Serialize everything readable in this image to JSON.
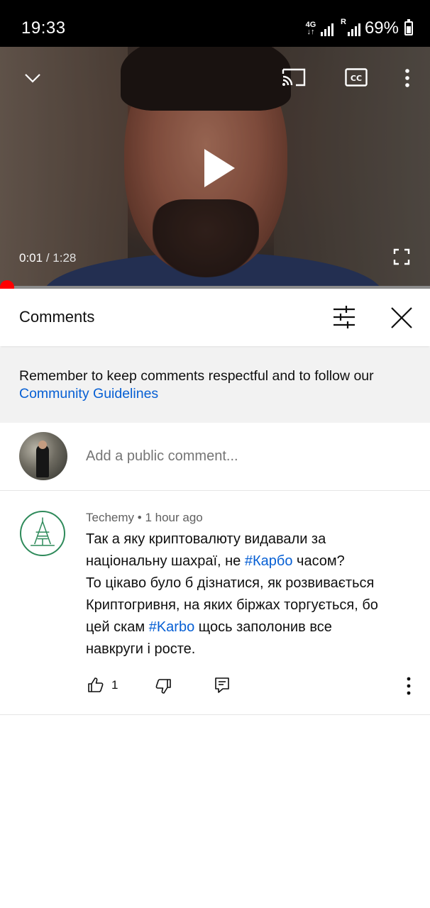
{
  "status_bar": {
    "time": "19:33",
    "network": "4G",
    "roaming": "R",
    "battery": "69%"
  },
  "player": {
    "current_time": "0:01",
    "separator": "/",
    "duration": "1:28",
    "progress_fraction": 0.0125,
    "icons": [
      "chevron-down-icon",
      "cast-icon",
      "captions-icon",
      "more-vert-icon",
      "play-icon",
      "fullscreen-icon"
    ]
  },
  "comments_panel": {
    "title": "Comments",
    "notice_text": "Remember to keep comments respectful and to follow our ",
    "notice_link": "Community Guidelines",
    "add_comment_placeholder": "Add a public comment..."
  },
  "comments": [
    {
      "author": "Techemy",
      "dot": "•",
      "time": "1 hour ago",
      "line1_a": "Так а яку криптовалюту видавали за",
      "line2_a": "національну шахраї, не ",
      "line2_tag": "#Карбо",
      "line2_b": " часом?",
      "line3": "То цікаво було б дізнатися, як розвивається",
      "line4": "Криптогривня, на яких біржах торгується, бо",
      "line5_a": "цей скам ",
      "line5_tag": "#Karbo",
      "line5_b": " щось заполонив все",
      "line6": "навкруги і росте.",
      "likes": "1"
    }
  ],
  "colors": {
    "link": "#065fd4",
    "progress": "#ff0000",
    "notice_bg": "#f2f2f2",
    "status_bg": "#000000"
  }
}
